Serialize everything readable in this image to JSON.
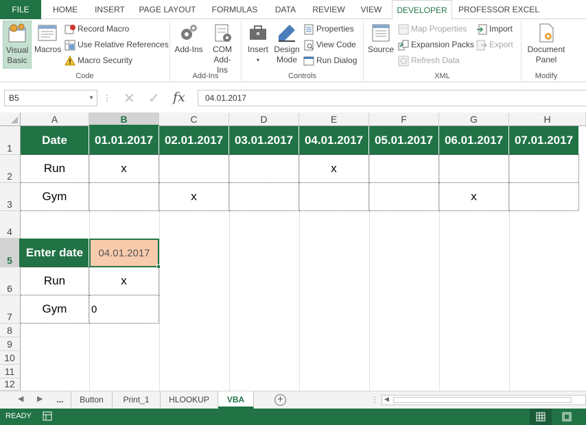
{
  "tabs": [
    "FILE",
    "HOME",
    "INSERT",
    "PAGE LAYOUT",
    "FORMULAS",
    "DATA",
    "REVIEW",
    "VIEW",
    "DEVELOPER",
    "PROFESSOR EXCEL"
  ],
  "ribbon": {
    "code": {
      "label": "Code",
      "visual_basic": "Visual Basic",
      "macros": "Macros",
      "record_macro": "Record Macro",
      "relative_refs": "Use Relative References",
      "macro_security": "Macro Security"
    },
    "addins": {
      "label": "Add-Ins",
      "addins": "Add-Ins",
      "com": "COM Add-Ins"
    },
    "controls": {
      "label": "Controls",
      "insert": "Insert",
      "design_mode": "Design Mode",
      "properties": "Properties",
      "view_code": "View Code",
      "run_dialog": "Run Dialog"
    },
    "xml": {
      "label": "XML",
      "source": "Source",
      "map_properties": "Map Properties",
      "expansion_packs": "Expansion Packs",
      "refresh_data": "Refresh Data",
      "import": "Import",
      "export": "Export"
    },
    "modify": {
      "label": "Modify",
      "document_panel": "Document Panel"
    }
  },
  "formula_bar": {
    "name_box": "B5",
    "formula": "04.01.2017"
  },
  "columns": [
    "A",
    "B",
    "C",
    "D",
    "E",
    "F",
    "G",
    "H"
  ],
  "rows": [
    "1",
    "2",
    "3",
    "4",
    "5",
    "6",
    "7",
    "8",
    "9",
    "10",
    "11",
    "12"
  ],
  "table": {
    "header": [
      "Date",
      "01.01.2017",
      "02.01.2017",
      "03.01.2017",
      "04.01.2017",
      "05.01.2017",
      "06.01.2017",
      "07.01.2017"
    ],
    "run": [
      "Run",
      "x",
      "",
      "",
      "x",
      "",
      "",
      ""
    ],
    "gym": [
      "Gym",
      "",
      "x",
      "",
      "",
      "",
      "x",
      ""
    ]
  },
  "lookup": {
    "enter_date_label": "Enter date",
    "enter_date_value": "04.01.2017",
    "run_label": "Run",
    "run_value": "x",
    "gym_label": "Gym",
    "gym_value": "0"
  },
  "sheets": [
    "...",
    "Button",
    "Print_1",
    "HLOOKUP",
    "VBA"
  ],
  "active_sheet": "VBA",
  "status": "READY",
  "colors": {
    "accent": "#217346",
    "selected_cell": "#f8cbad"
  }
}
